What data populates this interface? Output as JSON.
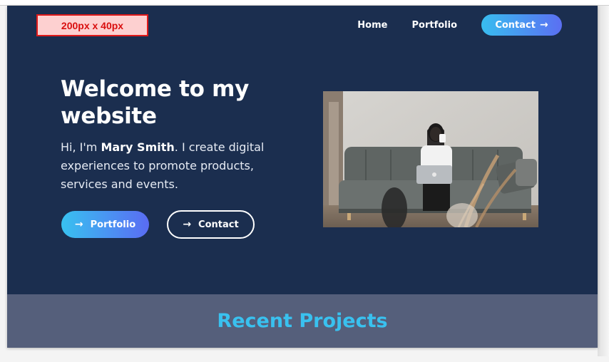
{
  "header": {
    "logo_placeholder": "200px x 40px",
    "nav": [
      {
        "label": "Home"
      },
      {
        "label": "Portfolio"
      }
    ],
    "contact_label": "Contact",
    "contact_icon": "arrow-right-icon"
  },
  "hero": {
    "title": "Welcome to my website",
    "intro_prefix": "Hi, I'm ",
    "intro_name": "Mary Smith",
    "intro_suffix": ". I create digital experiences to promote products, services and events.",
    "portfolio_button": "Portfolio",
    "contact_button": "Contact",
    "image_icon": "woman-on-sofa-photo"
  },
  "projects": {
    "title": "Recent Projects"
  },
  "colors": {
    "hero_bg": "#1b2e4f",
    "accent_gradient_start": "#38c1f0",
    "accent_gradient_end": "#5a6cf3",
    "projects_bg": "#555f7b",
    "projects_title": "#39c1ef",
    "logo_placeholder_bg": "#fdd0d0",
    "logo_placeholder_border": "#e01919"
  }
}
